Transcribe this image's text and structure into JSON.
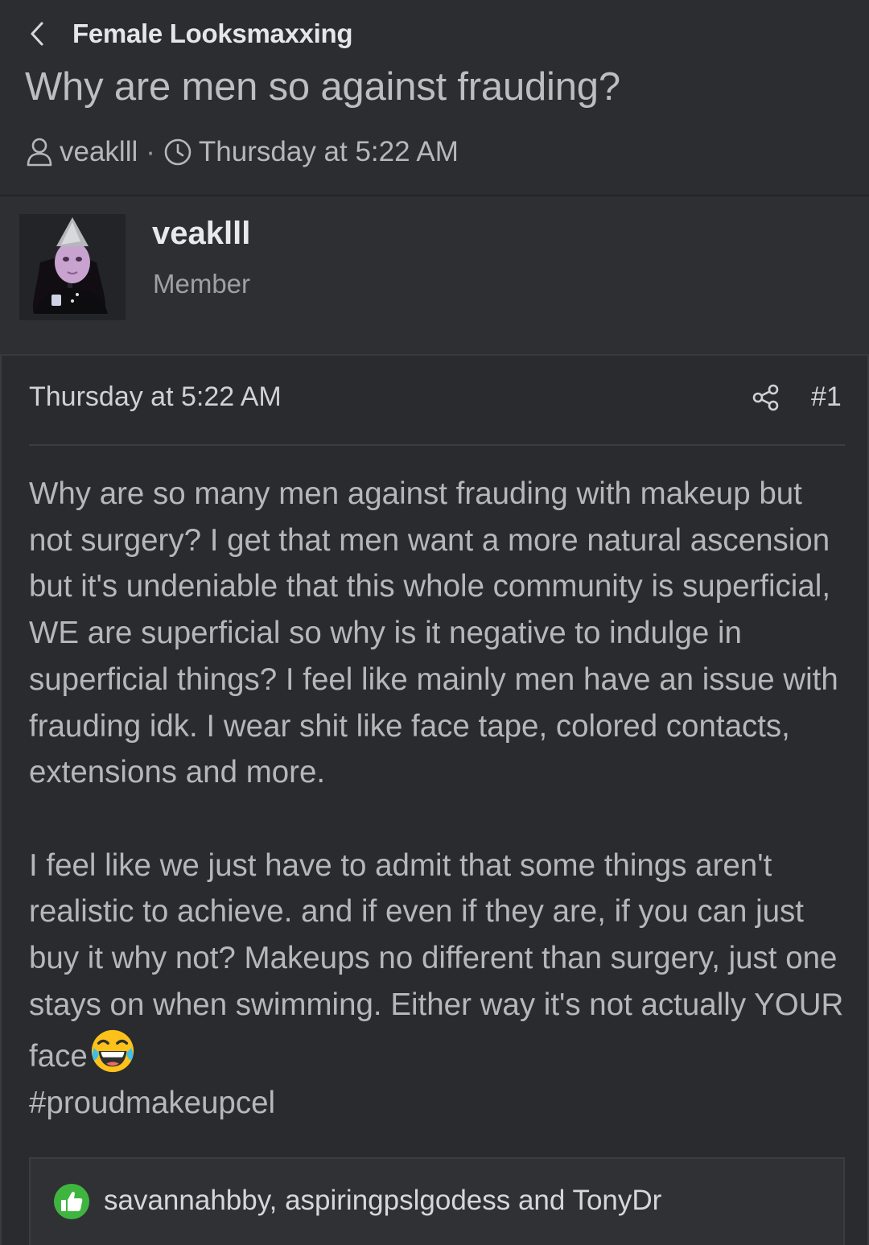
{
  "header": {
    "forum_name": "Female Looksmaxxing",
    "thread_title": "Why are men so against frauding?",
    "author": "veaklll",
    "separator": "·",
    "date": "Thursday at 5:22 AM"
  },
  "user": {
    "name": "veaklll",
    "title": "Member"
  },
  "post": {
    "date": "Thursday at 5:22 AM",
    "number": "#1",
    "paragraph1": "Why are so many men against frauding with makeup but not surgery? I get that men want a more natural ascension but it's undeniable that this whole community is superficial, WE are superficial so why is it negative to indulge in superficial things? I feel like mainly men have an issue with frauding idk. I wear shit like face tape, colored contacts, extensions and more.",
    "paragraph2": "I feel like we just have to admit that some things aren't realistic to achieve. and if even if they are, if you can just buy it why not? Makeups no different than surgery, just one stays on when swimming. Either way it's not actually YOUR face",
    "hashtag": "#proudmakeupcel"
  },
  "reactions": {
    "text": "savannahbby, aspiringpslgodess and TonyDr",
    "icon": "like-icon"
  },
  "colors": {
    "background": "#2a2b2f",
    "header_bg": "#2c2d31",
    "like_green": "#3fb53f"
  }
}
